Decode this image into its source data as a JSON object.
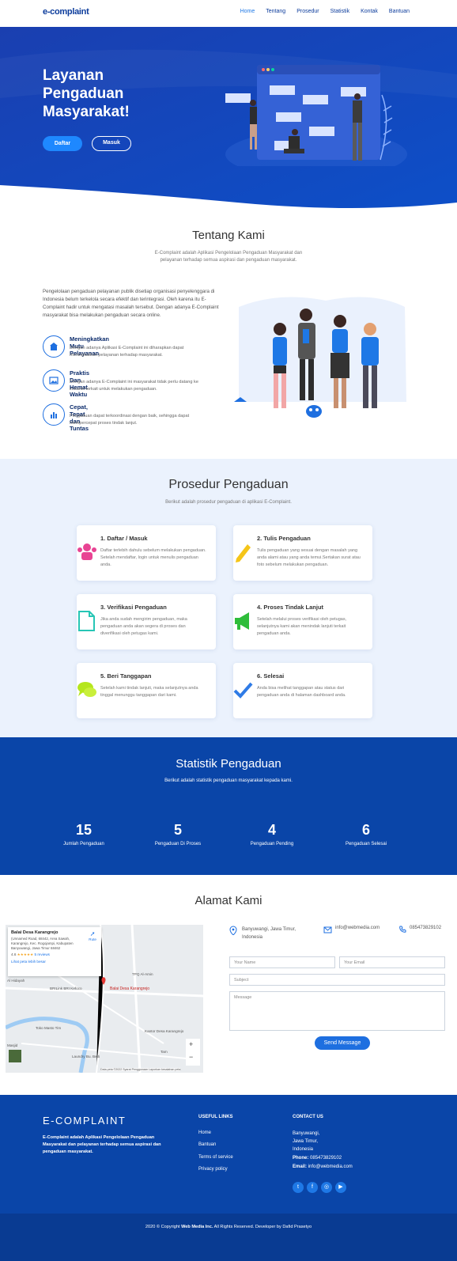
{
  "header": {
    "logo": "e-complaint",
    "nav": [
      "Home",
      "Tentang",
      "Prosedur",
      "Statistik",
      "Kontak",
      "Bantuan"
    ]
  },
  "hero": {
    "title": "Layanan Pengaduan Masyarakat!",
    "btn_daftar": "Daftar",
    "btn_masuk": "Masuk"
  },
  "about": {
    "title": "Tentang Kami",
    "subtitle": "E-Complaint adalah Aplikasi Pengelolaan Pengaduan Masyarakat dan pelayanan terhadap semua aspirasi dan pengaduan masyarakat.",
    "paragraph": "Pengelolaan pengaduan pelayanan publik disetiap organisasi penyelenggara di Indonesia belum terkelola secara efektif dan terintegrasi. Oleh karena itu E-Complaint hadir untuk mengatasi masalah tersebut. Dengan adanya E-Complaint masyarakat bisa melakukan pengaduan secara online.",
    "features": [
      {
        "title": "Meningkatkan Mutu Pelayanan",
        "desc": "Dengan adanya Aplikasi E-Complaint ini diharapkan dapat meningkatkan pelayanan terhadap masyarakat.",
        "icon": "building-icon"
      },
      {
        "title": "Praktis Dan Hemat Waktu",
        "desc": "Dengan adanya E-Complaint ini masyarakat tidak perlu datang ke instansi terkait untuk melakukan pengaduan.",
        "icon": "image-icon"
      },
      {
        "title": "Cepat, Tepat dan Tuntas",
        "desc": "Pengaduan dapat terkoordinasi dengan baik, sehingga dapat mempercepat proses tindak lanjut.",
        "icon": "chart-icon"
      }
    ]
  },
  "prosedur": {
    "title": "Prosedur Pengaduan",
    "subtitle": "Berikut adalah prosedur pengaduan di aplikasi E-Complaint.",
    "cards": [
      {
        "title": "1. Daftar / Masuk",
        "desc": "Daftar terlebih dahulu sebelum melakukan pengaduan. Setelah mendaftar, login untuk menulis pengaduan anda.",
        "icon": "users-icon",
        "color": "#e84393"
      },
      {
        "title": "2. Tulis Pengaduan",
        "desc": "Tulis pengaduan yang sesuai dengan masalah yang anda alami atau yang anda temui.Sertakan surat atau foto sebelum melakukan pengaduan.",
        "icon": "pencil-icon",
        "color": "#f5c518"
      },
      {
        "title": "3. Verifikasi Pengaduan",
        "desc": "Jika anda sudah mengirim pengaduan, maka pengaduan anda akan segera di proses dan diverifikasi oleh petugas kami.",
        "icon": "document-icon",
        "color": "#27c6b5"
      },
      {
        "title": "4. Proses Tindak Lanjut",
        "desc": "Setelah melalui proses verifikasi oleh petugas, selanjutnya kami akan menindak lanjuti terkait pengaduan anda.",
        "icon": "megaphone-icon",
        "color": "#2ebd3a"
      },
      {
        "title": "5. Beri Tanggapan",
        "desc": "Setelah kami tindak lanjuti, maka selanjutnya anda tinggal menunggu tanggapan dari kami.",
        "icon": "chat-icon",
        "color": "#b5e61d"
      },
      {
        "title": "6. Selesai",
        "desc": "Anda bisa melihat tanggapan atau status dari pengaduan anda di halaman dashboard anda.",
        "icon": "check-icon",
        "color": "#2f7be6"
      }
    ]
  },
  "statistik": {
    "title": "Statistik Pengaduan",
    "subtitle": "Berikut adalah statistik pengaduan masyarakat kepada kami.",
    "items": [
      {
        "value": "15",
        "label": "Jumlah Pengaduan"
      },
      {
        "value": "5",
        "label": "Pengaduan Di Proses"
      },
      {
        "value": "4",
        "label": "Pengaduan Pending"
      },
      {
        "value": "6",
        "label": "Pengaduan Selesai"
      }
    ]
  },
  "alamat": {
    "title": "Alamat Kami",
    "map": {
      "place": "Balai Desa Karangrejo",
      "address": "(Unnamed Road, 68442, Area Sawah, Karangrejo, Kec. Rogojampi, Kabupaten Banyuwangi, Jawa Timur 68462",
      "rating": "4.6",
      "reviews": "5 reviews",
      "larger": "Lihat peta lebih besar",
      "directions": "Rute",
      "labels": [
        "Toko Masto Tim",
        "TPQ Al-Amin",
        "Kantor Desa Karangrejo",
        "BRILink BRI Kefoco",
        "Laundry Bu. Betti",
        "Al Hidayah",
        "Masjid",
        "Tam"
      ],
      "pin_label": "Balai Desa Karangrejo",
      "footer": "Data peta ©2022   Syarat Penggunaan   Laporkan kesalahan peta"
    },
    "contacts": [
      {
        "text": "Banyuwangi, Jawa Timur, Indonesia",
        "icon": "location-icon"
      },
      {
        "text": "info@webmedia.com",
        "icon": "mail-icon"
      },
      {
        "text": "085473829102",
        "icon": "phone-icon"
      }
    ],
    "form": {
      "name": "Your Name",
      "email": "Your Email",
      "subject": "Subject",
      "message": "Message",
      "send": "Send Message"
    }
  },
  "footer": {
    "brand": "E-COMPLAINT",
    "desc": "E-Complaint adalah Aplikasi Pengelolaan Pengaduan Masyarakat dan pelayanan terhadap semua aspirasi dan pengaduan masyarakat.",
    "links_title": "USEFUL LINKS",
    "links": [
      "Home",
      "Bantuan",
      "Terms of service",
      "Privacy policy"
    ],
    "contact_title": "CONTACT US",
    "contact_lines": [
      "Banyuwangi,",
      "Jawa Timur,",
      "Indonesia"
    ],
    "phone_label": "Phone:",
    "phone": "085473829102",
    "email_label": "Email:",
    "email": "info@webmedia.com",
    "social": [
      "twitter-icon",
      "facebook-icon",
      "instagram-icon",
      "youtube-icon"
    ],
    "copyright_pre": "2020 © Copyright ",
    "copyright_brand": "Web Media Inc.",
    "copyright_post": " All Rights Reserved. Developer by Dafid Prasetyo"
  }
}
